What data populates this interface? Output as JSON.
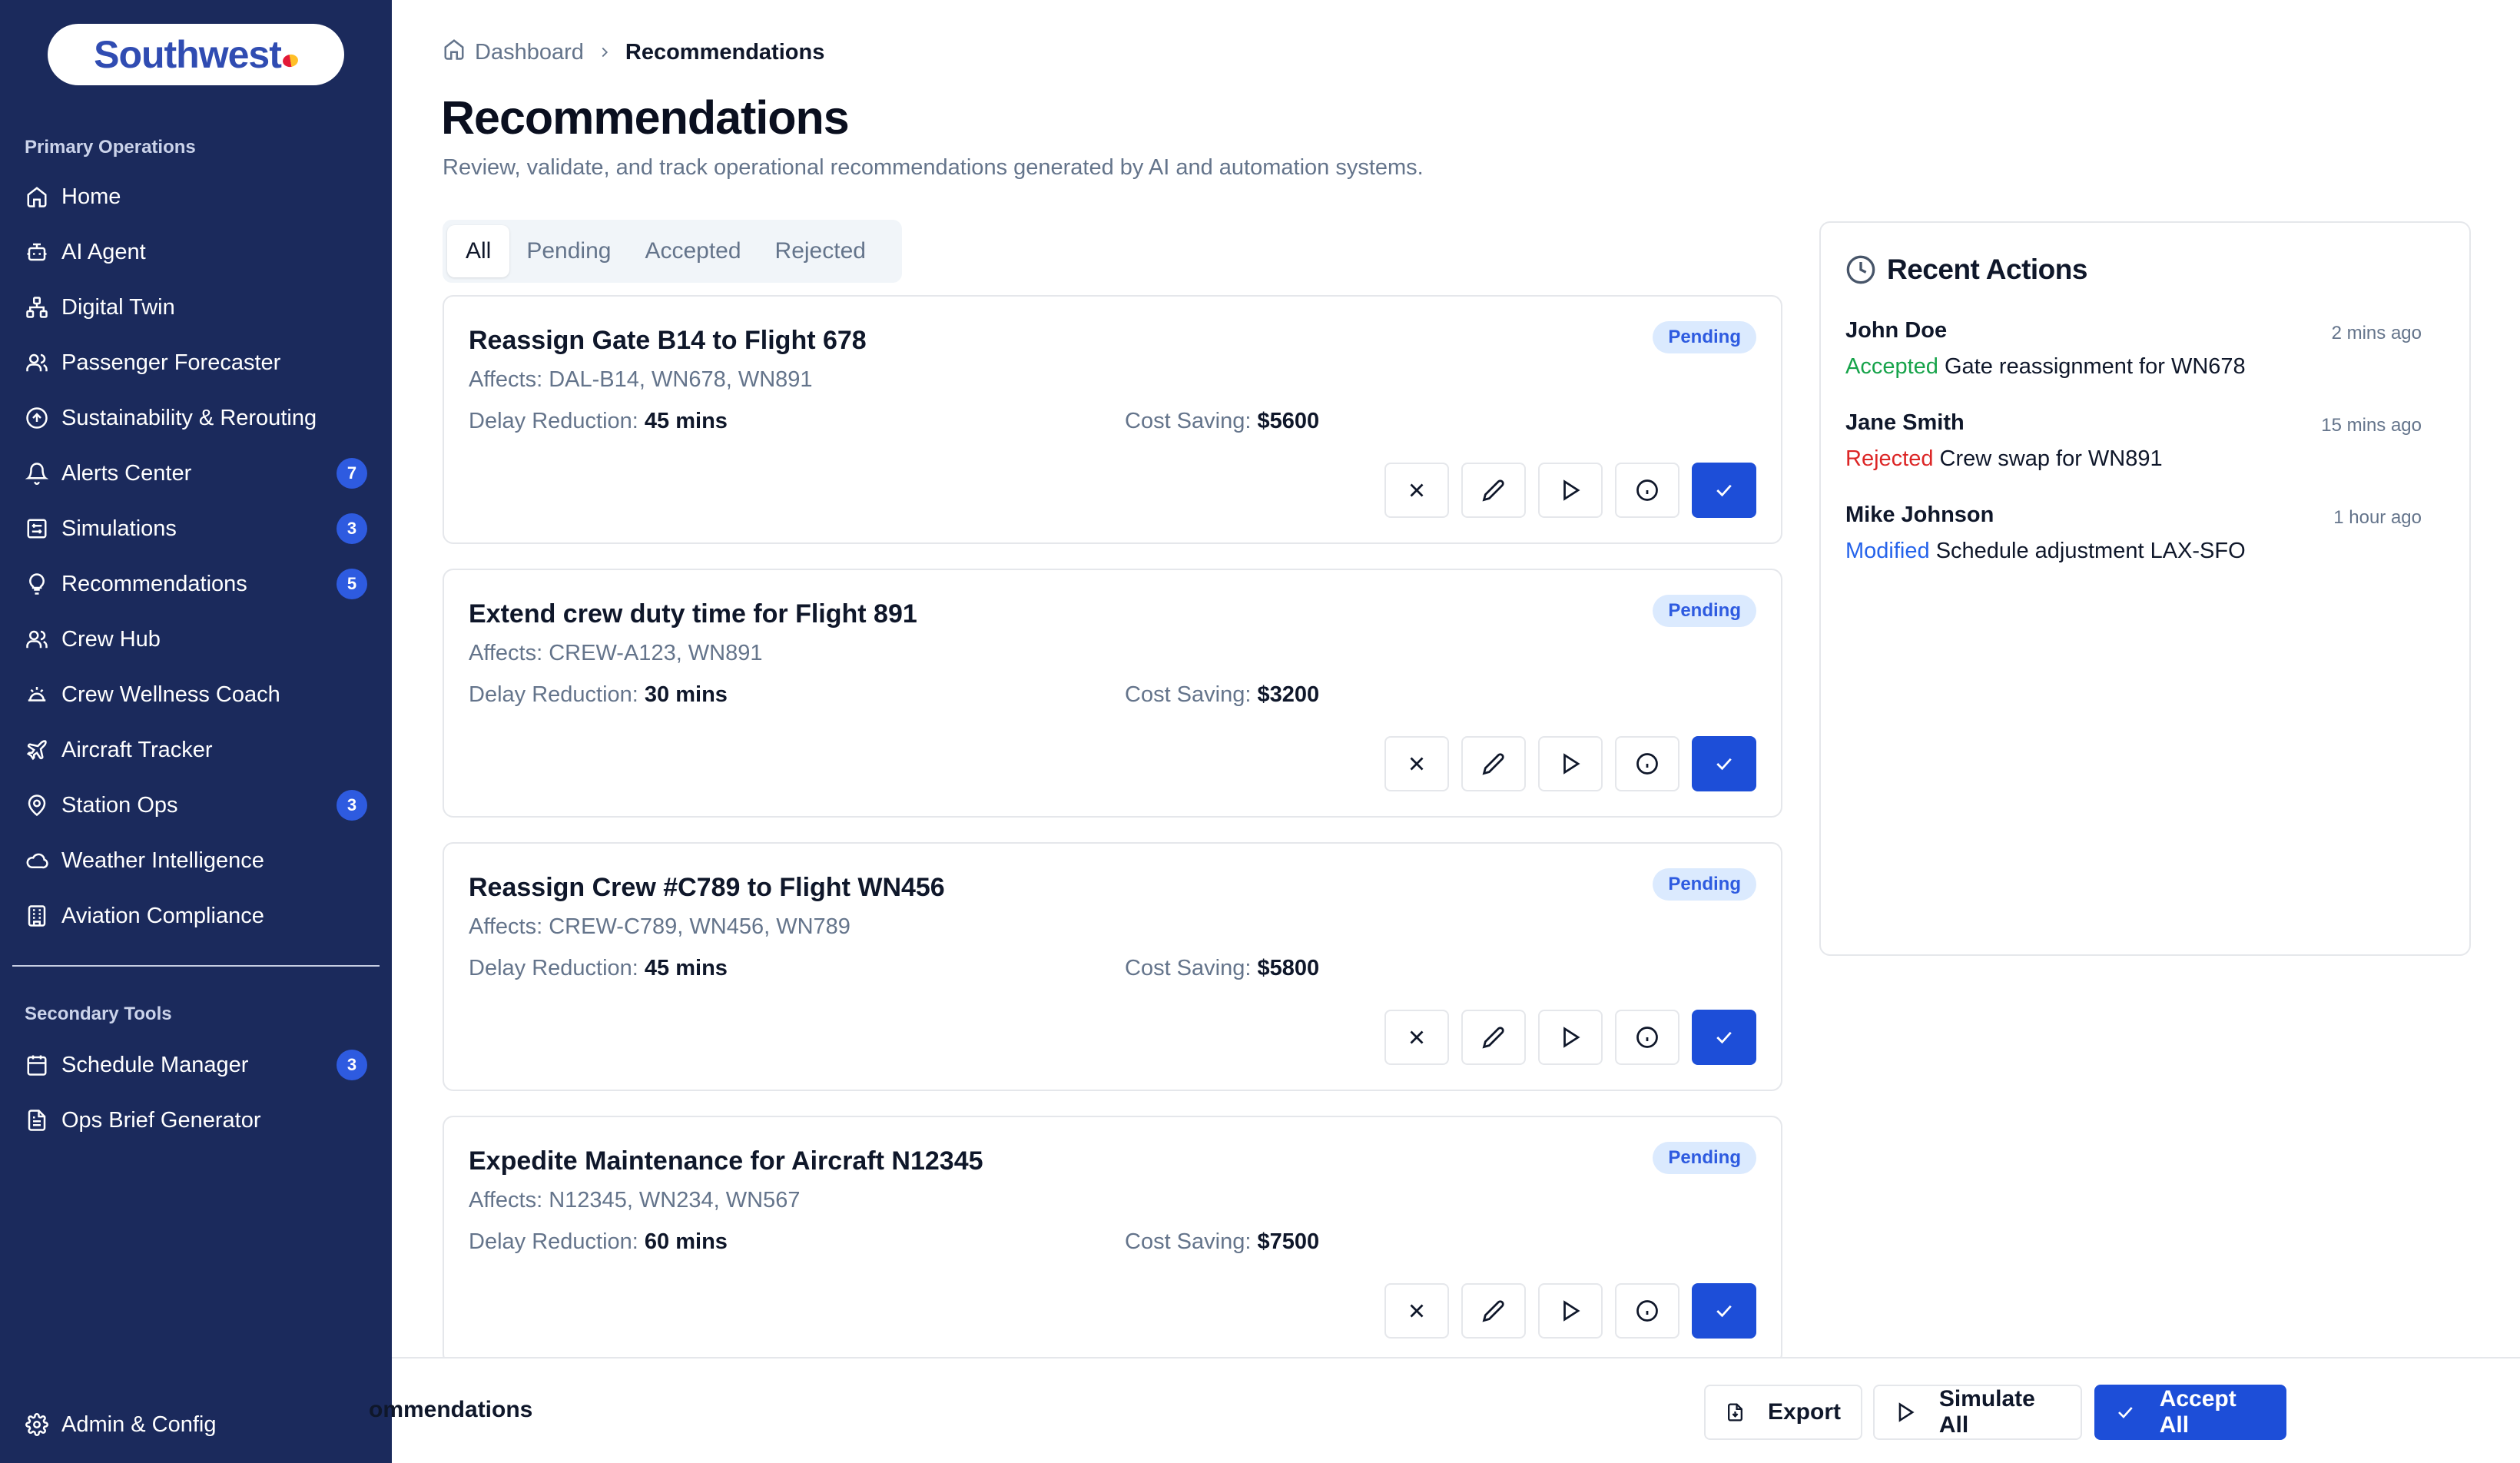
{
  "brand": {
    "logo_text": "Southwest"
  },
  "sidebar": {
    "primary_label": "Primary Operations",
    "secondary_label": "Secondary Tools",
    "primary": [
      {
        "label": "Home",
        "icon": "home-icon"
      },
      {
        "label": "AI Agent",
        "icon": "bot-icon"
      },
      {
        "label": "Digital Twin",
        "icon": "network-icon"
      },
      {
        "label": "Passenger Forecaster",
        "icon": "users-icon"
      },
      {
        "label": "Sustainability & Rerouting",
        "icon": "circle-arrow-icon"
      },
      {
        "label": "Alerts Center",
        "icon": "bell-icon",
        "badge": "7"
      },
      {
        "label": "Simulations",
        "icon": "simulation-icon",
        "badge": "3"
      },
      {
        "label": "Recommendations",
        "icon": "lightbulb-icon",
        "badge": "5"
      },
      {
        "label": "Crew Hub",
        "icon": "users-icon"
      },
      {
        "label": "Crew Wellness Coach",
        "icon": "wellness-icon"
      },
      {
        "label": "Aircraft Tracker",
        "icon": "plane-icon"
      },
      {
        "label": "Station Ops",
        "icon": "map-pin-icon",
        "badge": "3"
      },
      {
        "label": "Weather Intelligence",
        "icon": "cloud-icon"
      },
      {
        "label": "Aviation Compliance",
        "icon": "building-icon"
      }
    ],
    "secondary": [
      {
        "label": "Schedule Manager",
        "icon": "calendar-icon",
        "badge": "3"
      },
      {
        "label": "Ops Brief Generator",
        "icon": "file-text-icon"
      }
    ],
    "footer": {
      "label": "Admin & Config",
      "icon": "gear-icon"
    }
  },
  "breadcrumb": {
    "home": "Dashboard",
    "current": "Recommendations"
  },
  "page": {
    "title": "Recommendations",
    "description": "Review, validate, and track operational recommendations generated by AI and automation systems."
  },
  "tabs": [
    "All",
    "Pending",
    "Accepted",
    "Rejected"
  ],
  "labels": {
    "delay": "Delay Reduction:",
    "cost": "Cost Saving:"
  },
  "recommendations": [
    {
      "title": "Reassign Gate B14 to Flight 678",
      "affects": "Affects: DAL-B14, WN678, WN891",
      "delay": "45 mins",
      "cost": "$5600",
      "status": "Pending"
    },
    {
      "title": "Extend crew duty time for Flight 891",
      "affects": "Affects: CREW-A123, WN891",
      "delay": "30 mins",
      "cost": "$3200",
      "status": "Pending"
    },
    {
      "title": "Reassign Crew #C789 to Flight WN456",
      "affects": "Affects: CREW-C789, WN456, WN789",
      "delay": "45 mins",
      "cost": "$5800",
      "status": "Pending"
    },
    {
      "title": "Expedite Maintenance for Aircraft N12345",
      "affects": "Affects: N12345, WN234, WN567",
      "delay": "60 mins",
      "cost": "$7500",
      "status": "Pending"
    }
  ],
  "recent_actions": {
    "title": "Recent Actions",
    "items": [
      {
        "user": "John Doe",
        "time": "2 mins ago",
        "status": "Accepted",
        "detail": "Gate reassignment for WN678"
      },
      {
        "user": "Jane Smith",
        "time": "15 mins ago",
        "status": "Rejected",
        "detail": "Crew swap for WN891"
      },
      {
        "user": "Mike Johnson",
        "time": "1 hour ago",
        "status": "Modified",
        "detail": "Schedule adjustment LAX-SFO"
      }
    ]
  },
  "bottom_bar": {
    "label": "ommendations",
    "export": "Export",
    "simulate_all": "Simulate All",
    "accept_all": "Accept All"
  },
  "colors": {
    "sidebar_bg": "#1b2a5c",
    "accent": "#1d4ed8",
    "badge": "#2e5be0",
    "accepted": "#16a34a",
    "rejected": "#dc2626",
    "modified": "#2563eb"
  }
}
